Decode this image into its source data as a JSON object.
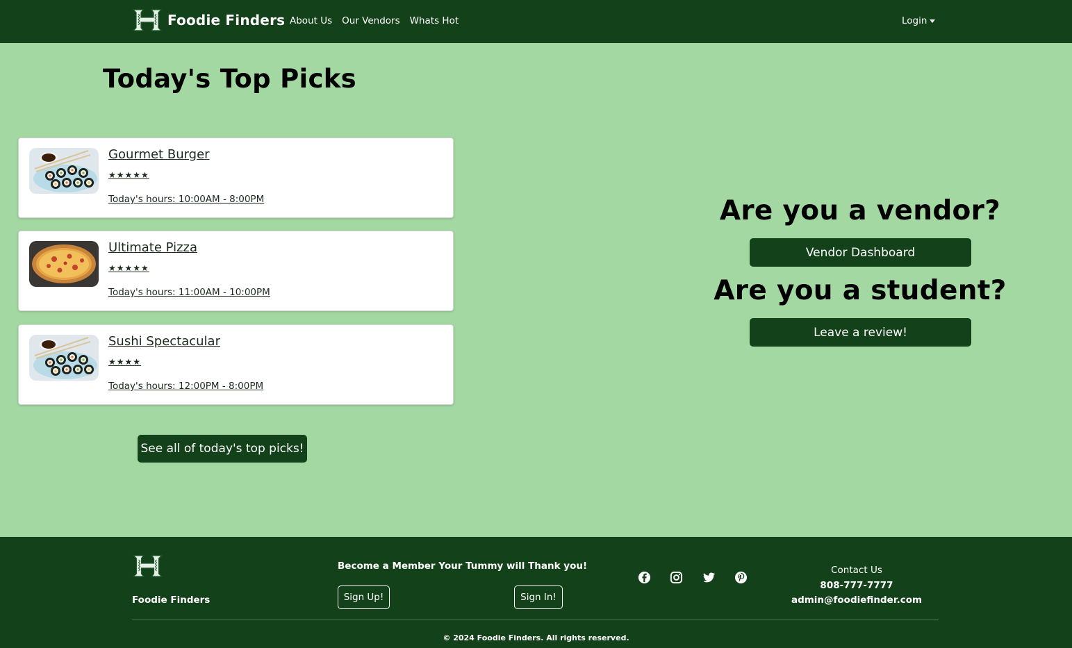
{
  "nav": {
    "brand": "Foodie Finders",
    "links": [
      "About Us",
      "Our Vendors",
      "Whats Hot"
    ],
    "login": "Login"
  },
  "main": {
    "title": "Today's Top Picks",
    "picks": [
      {
        "name": "Gourmet Burger",
        "stars": "★★★★★",
        "hours": "Today's hours: 10:00AM - 8:00PM",
        "image": "sushi-image"
      },
      {
        "name": "Ultimate Pizza",
        "stars": "★★★★★",
        "hours": "Today's hours: 11:00AM - 10:00PM",
        "image": "pizza-image"
      },
      {
        "name": "Sushi Spectacular",
        "stars": "★★★★",
        "hours": "Today's hours: 12:00PM - 8:00PM",
        "image": "sushi-image"
      }
    ],
    "see_all": "See all of today's top picks!"
  },
  "cta": {
    "vendor_heading": "Are you a vendor?",
    "vendor_button": "Vendor Dashboard",
    "student_heading": "Are you a student?",
    "student_button": "Leave a review!"
  },
  "footer": {
    "brand": "Foodie Finders",
    "member_text": "Become a Member Your Tummy will Thank you!",
    "signup": "Sign Up!",
    "signin": "Sign In!",
    "social_icons": [
      "facebook-icon",
      "instagram-icon",
      "twitter-icon",
      "pinterest-icon"
    ],
    "contact_heading": "Contact Us",
    "phone": "808-777-7777",
    "email": "admin@foodiefinder.com",
    "copyright": "© 2024 Foodie Finders. All rights reserved."
  },
  "colors": {
    "primary": "#134119",
    "background": "#a3d8a2",
    "card": "#ffffff"
  }
}
